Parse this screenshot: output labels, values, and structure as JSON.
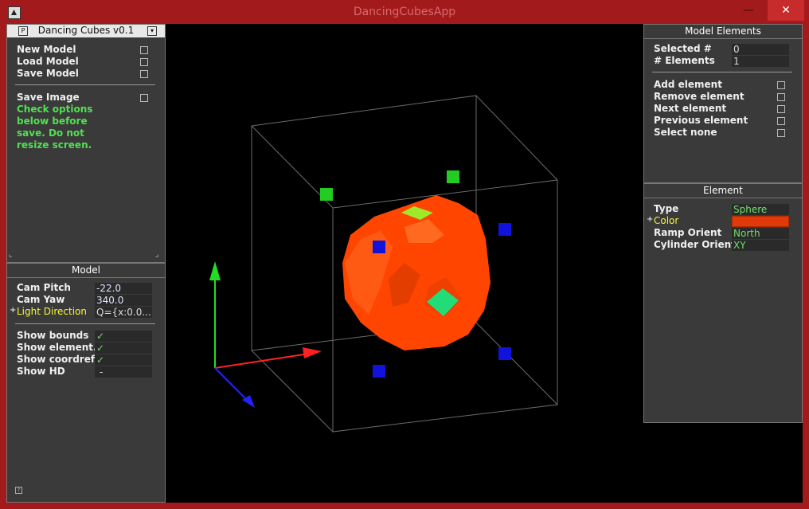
{
  "window": {
    "title": "DancingCubesApp",
    "min": "—",
    "max": "☐",
    "close": "✕"
  },
  "main_panel": {
    "title": "Dancing Cubes v0.1",
    "items": [
      "New Model",
      "Load Model",
      "Save Model"
    ],
    "save_image": "Save Image",
    "note": [
      "Check options",
      "below before",
      "save. Do not",
      "resize screen."
    ]
  },
  "model_panel": {
    "title": "Model",
    "fields": [
      {
        "label": "Cam Pitch",
        "value": "-22.0"
      },
      {
        "label": "Cam Yaw",
        "value": "340.0"
      },
      {
        "label": "Light Direction",
        "value": "Q={x:0.0..."
      }
    ],
    "toggles": [
      {
        "label": "Show bounds",
        "value": "✓"
      },
      {
        "label": "Show element..",
        "value": "✓"
      },
      {
        "label": "Show coordref",
        "value": "✓"
      },
      {
        "label": "Show HD",
        "value": "-"
      }
    ]
  },
  "elements_panel": {
    "title": "Model Elements",
    "fields": [
      {
        "label": "Selected #",
        "value": "0"
      },
      {
        "label": "# Elements",
        "value": "1"
      }
    ],
    "actions": [
      "Add element",
      "Remove element",
      "Next element",
      "Previous element",
      "Select none"
    ]
  },
  "element_panel": {
    "title": "Element",
    "fields": [
      {
        "label": "Type",
        "value": "Sphere"
      },
      {
        "label": "Color",
        "value": ""
      },
      {
        "label": "Ramp Orient",
        "value": "North"
      },
      {
        "label": "Cylinder Orient",
        "value": "XY"
      }
    ],
    "color_hex": "#e03a0a"
  },
  "colors": {
    "accent": "#a31a1c",
    "sphere": "#ff4500",
    "marker": "#00cc00",
    "axis_x": "#ff2222",
    "axis_y": "#22dd22",
    "axis_z": "#2222ff"
  }
}
